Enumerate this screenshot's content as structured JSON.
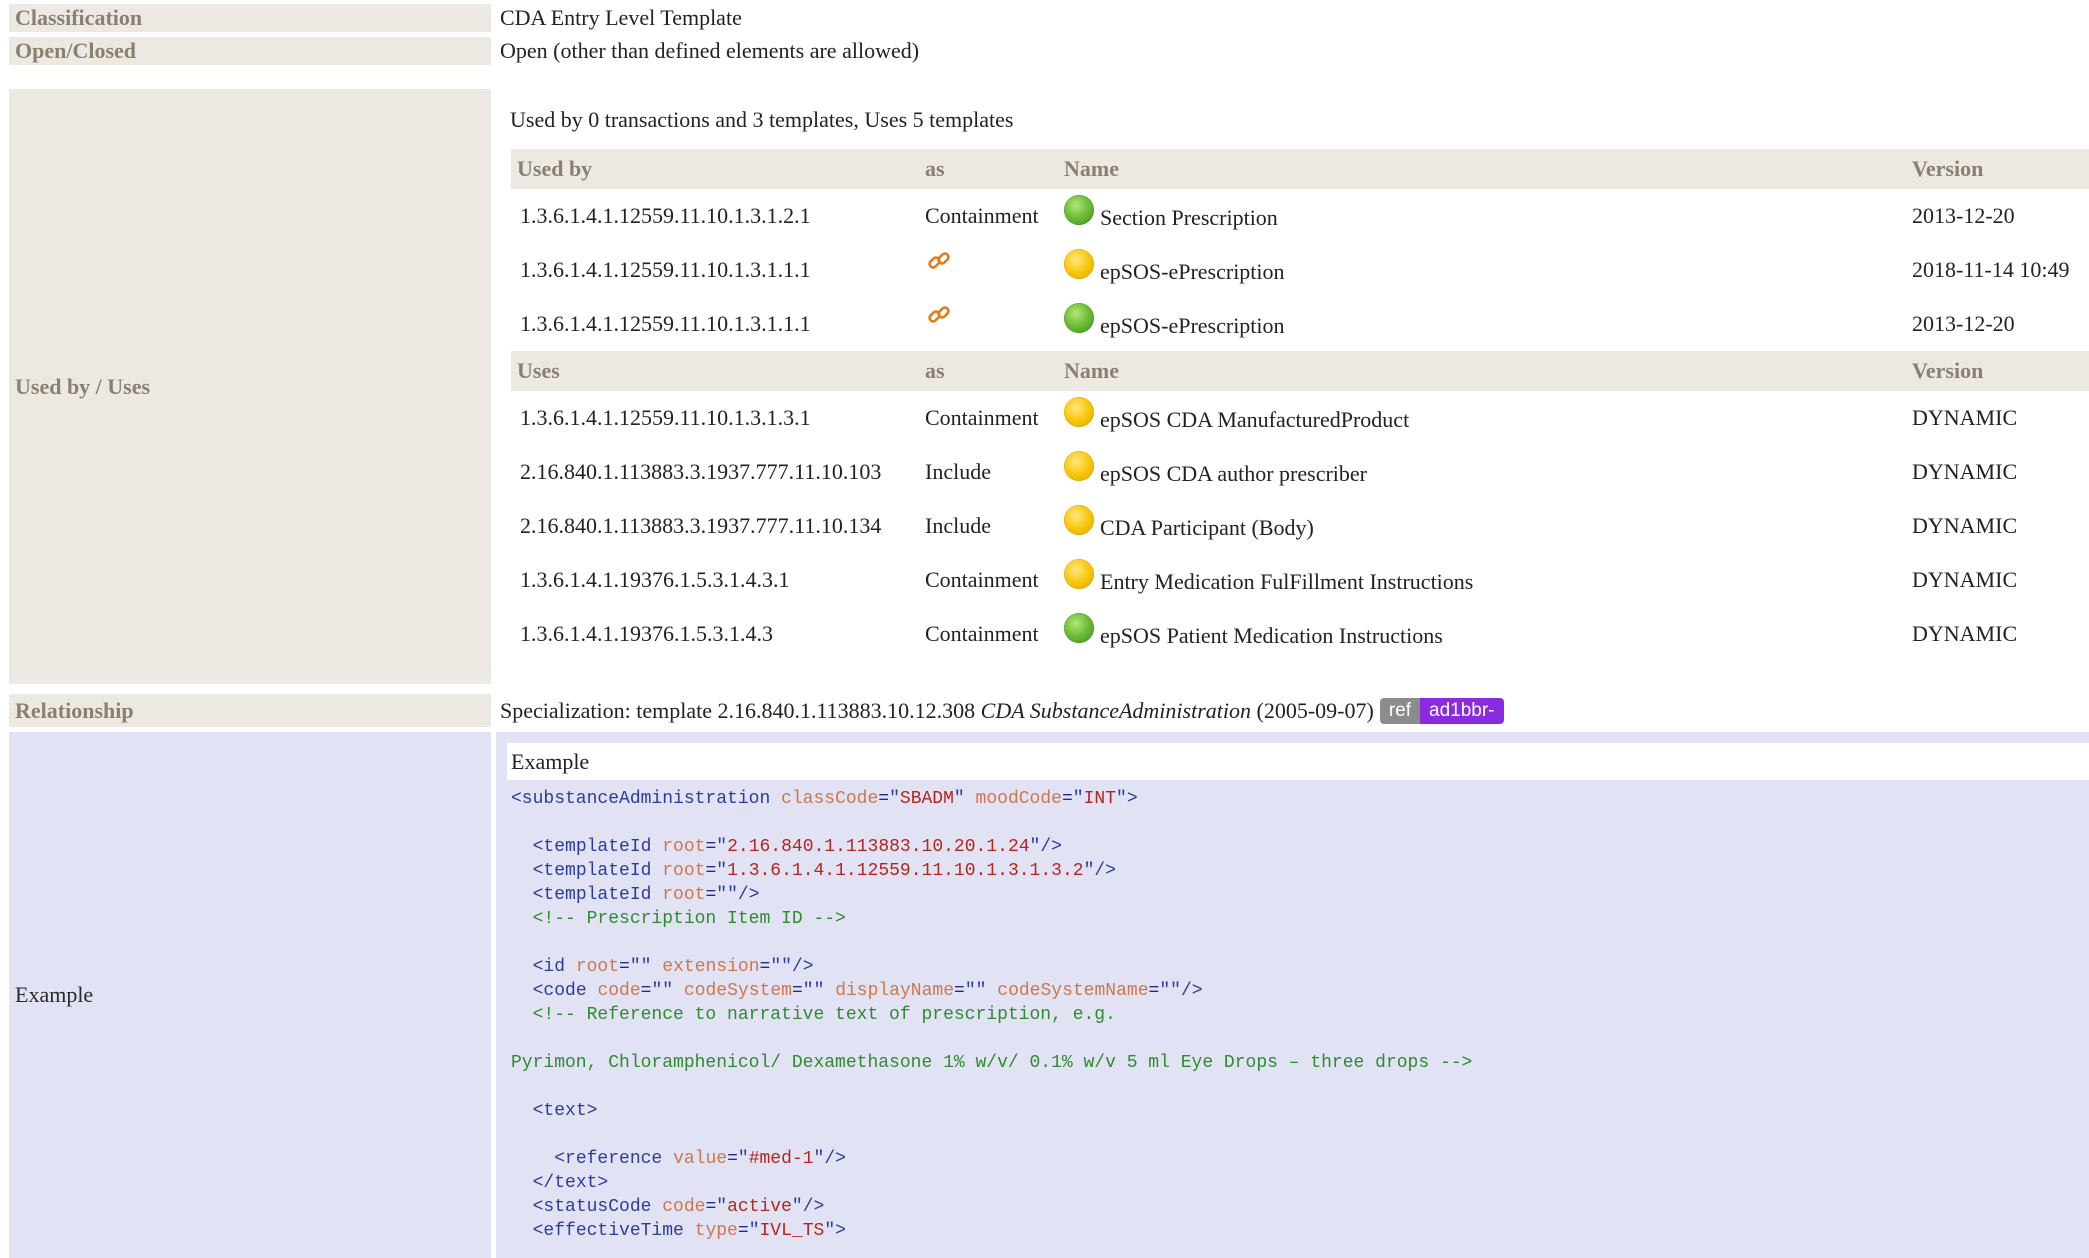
{
  "rows": {
    "classification": {
      "label": "Classification",
      "value": "CDA Entry Level Template"
    },
    "open_closed": {
      "label": "Open/Closed",
      "value": "Open (other than defined elements are allowed)"
    },
    "used_by_uses": {
      "label": "Used by / Uses"
    },
    "relationship": {
      "label": "Relationship",
      "prefix": "Specialization: template 2.16.840.1.113883.10.12.308",
      "template_name": "CDA SubstanceAdministration",
      "date": "(2005-09-07)",
      "badge_ref": "ref",
      "badge_id": "ad1bbr-"
    },
    "example": {
      "label": "Example"
    }
  },
  "usage_summary": "Used by 0 transactions and 3 templates, Uses 5 templates",
  "used_by_table": {
    "headers": [
      "Used by",
      "as",
      "Name",
      "Version"
    ],
    "rows": [
      {
        "oid": "1.3.6.1.4.1.12559.11.10.1.3.1.2.1",
        "as": "Containment",
        "status": "green",
        "name": "Section Prescription",
        "version": "2013-12-20"
      },
      {
        "oid": "1.3.6.1.4.1.12559.11.10.1.3.1.1.1",
        "as": "link-icon",
        "status": "yellow",
        "name": "epSOS-ePrescription",
        "version": "2018-11-14 10:49"
      },
      {
        "oid": "1.3.6.1.4.1.12559.11.10.1.3.1.1.1",
        "as": "link-icon",
        "status": "green",
        "name": "epSOS-ePrescription",
        "version": "2013-12-20"
      }
    ]
  },
  "uses_table": {
    "headers": [
      "Uses",
      "as",
      "Name",
      "Version"
    ],
    "rows": [
      {
        "oid": "1.3.6.1.4.1.12559.11.10.1.3.1.3.1",
        "as": "Containment",
        "status": "yellow",
        "name": "epSOS CDA ManufacturedProduct",
        "version": "DYNAMIC"
      },
      {
        "oid": "2.16.840.1.113883.3.1937.777.11.10.103",
        "as": "Include",
        "status": "yellow",
        "name": "epSOS CDA author prescriber",
        "version": "DYNAMIC"
      },
      {
        "oid": "2.16.840.1.113883.3.1937.777.11.10.134",
        "as": "Include",
        "status": "yellow",
        "name": "CDA Participant (Body)",
        "version": "DYNAMIC"
      },
      {
        "oid": "1.3.6.1.4.1.19376.1.5.3.1.4.3.1",
        "as": "Containment",
        "status": "yellow",
        "name": "Entry Medication FulFillment Instructions",
        "version": "DYNAMIC"
      },
      {
        "oid": "1.3.6.1.4.1.19376.1.5.3.1.4.3",
        "as": "Containment",
        "status": "green",
        "name": "epSOS Patient Medication Instructions",
        "version": "DYNAMIC"
      }
    ]
  },
  "example_caption": "Example",
  "code_lines": [
    "<substanceAdministration classCode=\"SBADM\" moodCode=\"INT\">",
    "",
    "  <templateId root=\"2.16.840.1.113883.10.20.1.24\"/>",
    "  <templateId root=\"1.3.6.1.4.1.12559.11.10.1.3.1.3.2\"/>",
    "  <templateId root=\"\"/>",
    "  <!-- Prescription Item ID -->",
    "",
    "  <id root=\"\" extension=\"\"/>",
    "  <code code=\"\" codeSystem=\"\" displayName=\"\" codeSystemName=\"\"/>",
    "  <!-- Reference to narrative text of prescription, e.g.",
    "",
    "Pyrimon, Chloramphenicol/ Dexamethasone 1% w/v/ 0.1% w/v 5 ml Eye Drops – three drops -->",
    "",
    "  <text>",
    "",
    "    <reference value=\"#med-1\"/>",
    "  </text>",
    "  <statusCode code=\"active\"/>",
    "  <effectiveTime type=\"IVL_TS\">"
  ],
  "colors": {
    "status_green": "#6fbf3a",
    "status_yellow": "#f7c70a",
    "label_bg": "#ece9e3",
    "example_bg": "#e1e3f5",
    "badge_ref": "#8c8c8c",
    "badge_id": "#8a2be2"
  }
}
